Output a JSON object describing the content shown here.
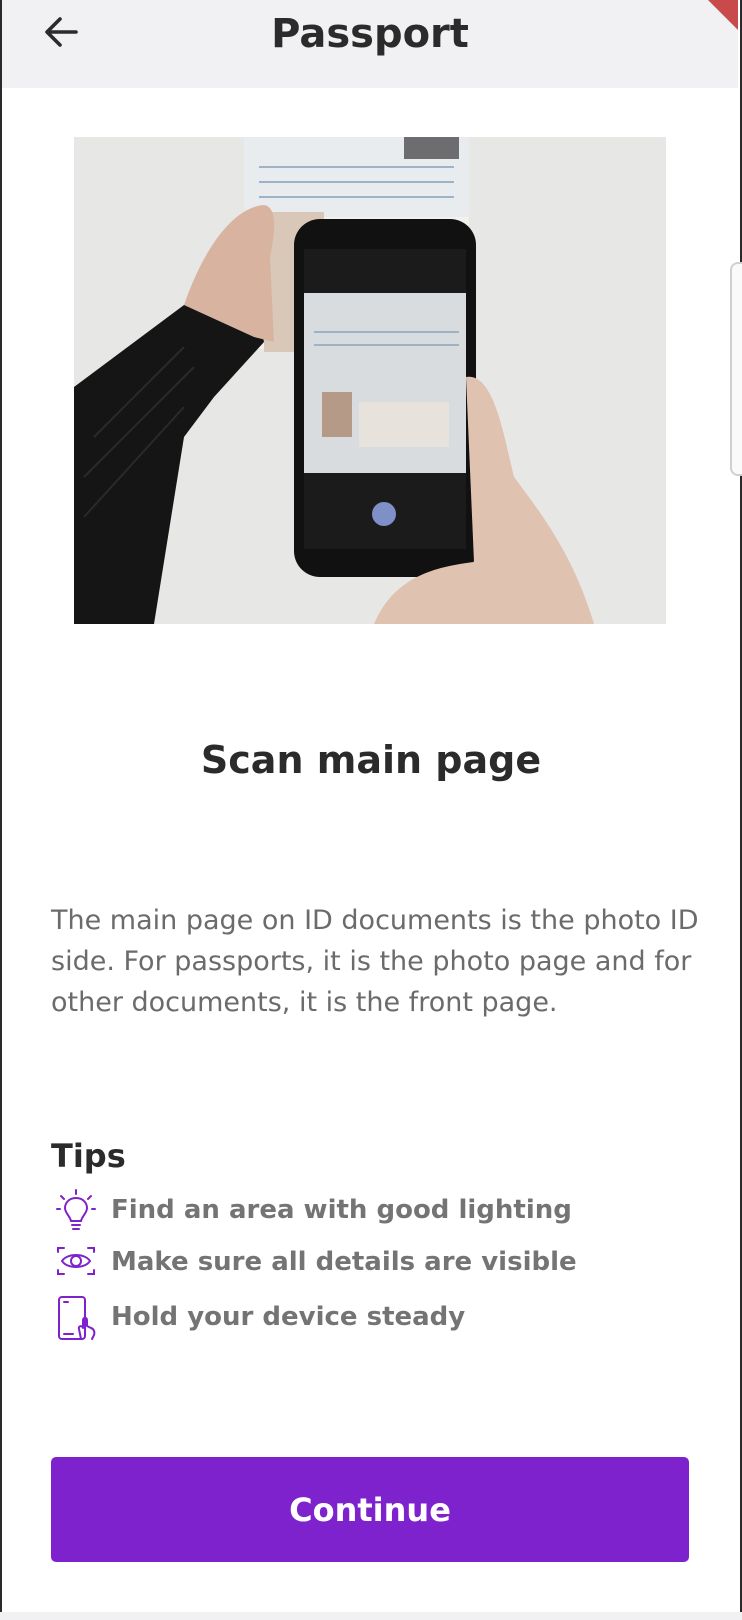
{
  "header": {
    "title": "Passport",
    "back_icon": "arrow-left-icon"
  },
  "main": {
    "heading": "Scan main page",
    "description": "The main page on ID documents is the photo ID side. For passports, it is the photo page and for other documents, it is the front page.",
    "tips_title": "Tips",
    "tips": [
      {
        "icon": "lightbulb-icon",
        "text": "Find an area with good lighting"
      },
      {
        "icon": "eye-icon",
        "text": "Make sure all details are visible"
      },
      {
        "icon": "phone-hand-icon",
        "text": "Hold your device steady"
      }
    ]
  },
  "footer": {
    "continue_label": "Continue"
  },
  "colors": {
    "accent": "#7e22ce",
    "header_bg": "#f1f1f4",
    "text": "#2b2b2b",
    "muted": "#6b6b6b"
  }
}
